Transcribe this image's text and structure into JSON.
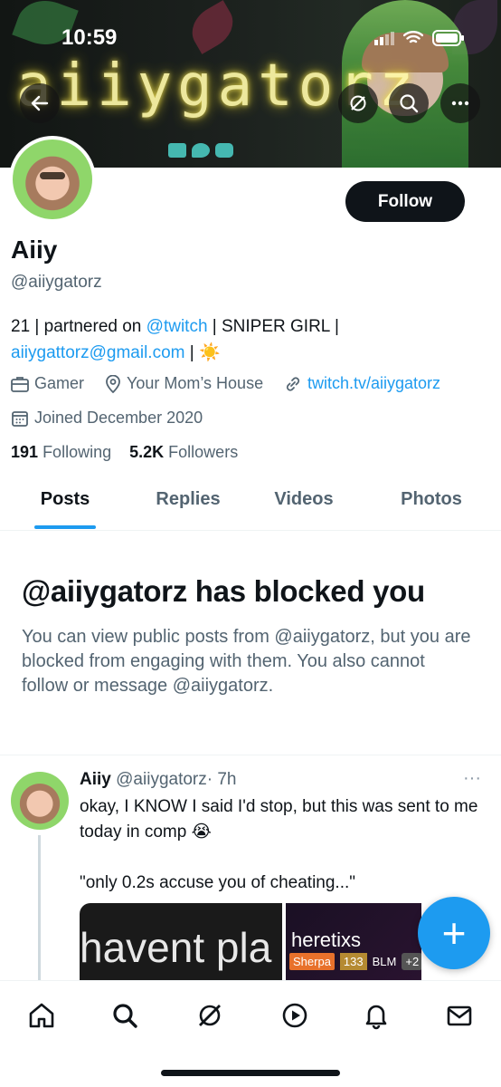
{
  "status_bar": {
    "time": "10:59"
  },
  "banner": {
    "neon_text": "aiiygatorz"
  },
  "profile": {
    "name": "Aiiy",
    "handle": "@aiiygatorz",
    "follow_label": "Follow",
    "bio_part1": "21 | partnered on ",
    "bio_link_twitch": "@twitch",
    "bio_part2": " | SNIPER GIRL |",
    "bio_email": "aiiygattorz@gmail.com",
    "bio_part3": " | ",
    "bio_emoji": "☀️",
    "category": "Gamer",
    "location": "Your Mom’s House",
    "website": "twitch.tv/aiiygatorz",
    "joined": "Joined December 2020",
    "following_count": "191",
    "following_label": "Following",
    "followers_count": "5.2K",
    "followers_label": "Followers"
  },
  "tabs": {
    "posts": "Posts",
    "replies": "Replies",
    "videos": "Videos",
    "photos": "Photos",
    "active": "Posts"
  },
  "blocked": {
    "title": "@aiiygatorz has blocked you",
    "body": "You can view public posts from @aiiygatorz, but you are blocked from engaging with them. You also cannot follow or message @aiiygatorz."
  },
  "tweet": {
    "name": "Aiiy",
    "handle": "@aiiygatorz",
    "time": "· 7h",
    "more": "···",
    "line1": "okay, I KNOW I said I'd stop, but this was sent to me today in comp 😭",
    "line2": "\"only 0.2s accuse you of cheating...\"",
    "media1_text": "havent pla",
    "media2_name": "heretixs",
    "media2_badge": "Sherpa",
    "media2_num": "133",
    "media2_tag": "BLM",
    "media2_plus": "+2"
  },
  "fab": {
    "label": "+"
  },
  "colors": {
    "accent": "#1d9bf0",
    "text": "#0f1419",
    "muted": "#536471"
  }
}
